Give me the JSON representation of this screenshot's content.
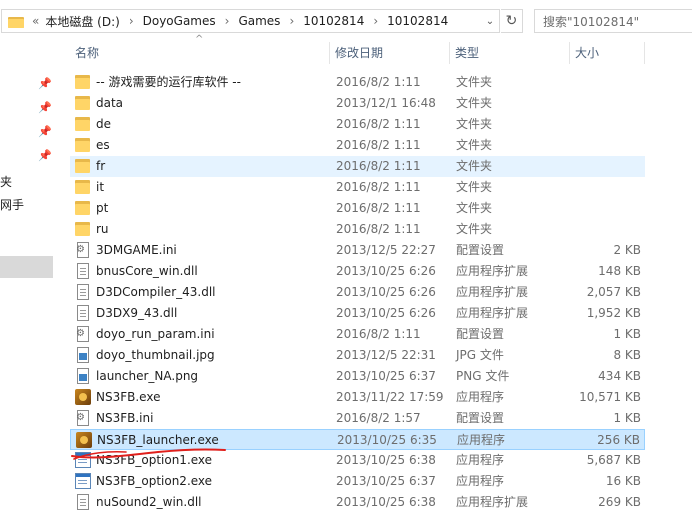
{
  "address_bar": {
    "lead": "«",
    "crumbs": [
      "本地磁盘 (D:)",
      "DoyoGames",
      "Games",
      "10102814",
      "10102814"
    ],
    "dropdown_glyph": "⌄",
    "refresh_glyph": "↻"
  },
  "search": {
    "placeholder": "搜索\"10102814\""
  },
  "nav_pane": {
    "items": [
      "夹",
      "网手"
    ]
  },
  "columns": {
    "name": "名称",
    "date": "修改日期",
    "type": "类型",
    "size": "大小"
  },
  "sort_glyph": "^",
  "files": [
    {
      "name": "-- 游戏需要的运行库软件 --",
      "date": "2016/8/2 1:11",
      "type": "文件夹",
      "size": "",
      "icon": "folder-icon"
    },
    {
      "name": "data",
      "date": "2013/12/1 16:48",
      "type": "文件夹",
      "size": "",
      "icon": "folder-icon"
    },
    {
      "name": "de",
      "date": "2016/8/2 1:11",
      "type": "文件夹",
      "size": "",
      "icon": "folder-icon"
    },
    {
      "name": "es",
      "date": "2016/8/2 1:11",
      "type": "文件夹",
      "size": "",
      "icon": "folder-icon"
    },
    {
      "name": "fr",
      "date": "2016/8/2 1:11",
      "type": "文件夹",
      "size": "",
      "icon": "folder-icon"
    },
    {
      "name": "it",
      "date": "2016/8/2 1:11",
      "type": "文件夹",
      "size": "",
      "icon": "folder-icon"
    },
    {
      "name": "pt",
      "date": "2016/8/2 1:11",
      "type": "文件夹",
      "size": "",
      "icon": "folder-icon"
    },
    {
      "name": "ru",
      "date": "2016/8/2 1:11",
      "type": "文件夹",
      "size": "",
      "icon": "folder-icon"
    },
    {
      "name": "3DMGAME.ini",
      "date": "2013/12/5 22:27",
      "type": "配置设置",
      "size": "2 KB",
      "icon": "ini-file-icon"
    },
    {
      "name": "bnusCore_win.dll",
      "date": "2013/10/25 6:26",
      "type": "应用程序扩展",
      "size": "148 KB",
      "icon": "dll-file-icon"
    },
    {
      "name": "D3DCompiler_43.dll",
      "date": "2013/10/25 6:26",
      "type": "应用程序扩展",
      "size": "2,057 KB",
      "icon": "dll-file-icon"
    },
    {
      "name": "D3DX9_43.dll",
      "date": "2013/10/25 6:26",
      "type": "应用程序扩展",
      "size": "1,952 KB",
      "icon": "dll-file-icon"
    },
    {
      "name": "doyo_run_param.ini",
      "date": "2016/8/2 1:11",
      "type": "配置设置",
      "size": "1 KB",
      "icon": "ini-file-icon"
    },
    {
      "name": "doyo_thumbnail.jpg",
      "date": "2013/12/5 22:31",
      "type": "JPG 文件",
      "size": "8 KB",
      "icon": "image-file-icon"
    },
    {
      "name": "launcher_NA.png",
      "date": "2013/10/25 6:37",
      "type": "PNG 文件",
      "size": "434 KB",
      "icon": "image-file-icon"
    },
    {
      "name": "NS3FB.exe",
      "date": "2013/11/22 17:59",
      "type": "应用程序",
      "size": "10,571 KB",
      "icon": "game-exe-icon"
    },
    {
      "name": "NS3FB.ini",
      "date": "2016/8/2 1:57",
      "type": "配置设置",
      "size": "1 KB",
      "icon": "ini-file-icon"
    },
    {
      "name": "NS3FB_launcher.exe",
      "date": "2013/10/25 6:35",
      "type": "应用程序",
      "size": "256 KB",
      "icon": "game-exe-icon"
    },
    {
      "name": "NS3FB_option1.exe",
      "date": "2013/10/25 6:38",
      "type": "应用程序",
      "size": "5,687 KB",
      "icon": "app-exe-icon"
    },
    {
      "name": "NS3FB_option2.exe",
      "date": "2013/10/25 6:37",
      "type": "应用程序",
      "size": "16 KB",
      "icon": "app-exe-icon"
    },
    {
      "name": "nuSound2_win.dll",
      "date": "2013/10/25 6:38",
      "type": "应用程序扩展",
      "size": "269 KB",
      "icon": "dll-file-icon"
    }
  ],
  "hover_row": "fr",
  "selected_row": "NS3FB_launcher.exe",
  "colors": {
    "hover": "#e5f3ff",
    "selected": "#cce8ff",
    "annotation": "#e0201c"
  }
}
